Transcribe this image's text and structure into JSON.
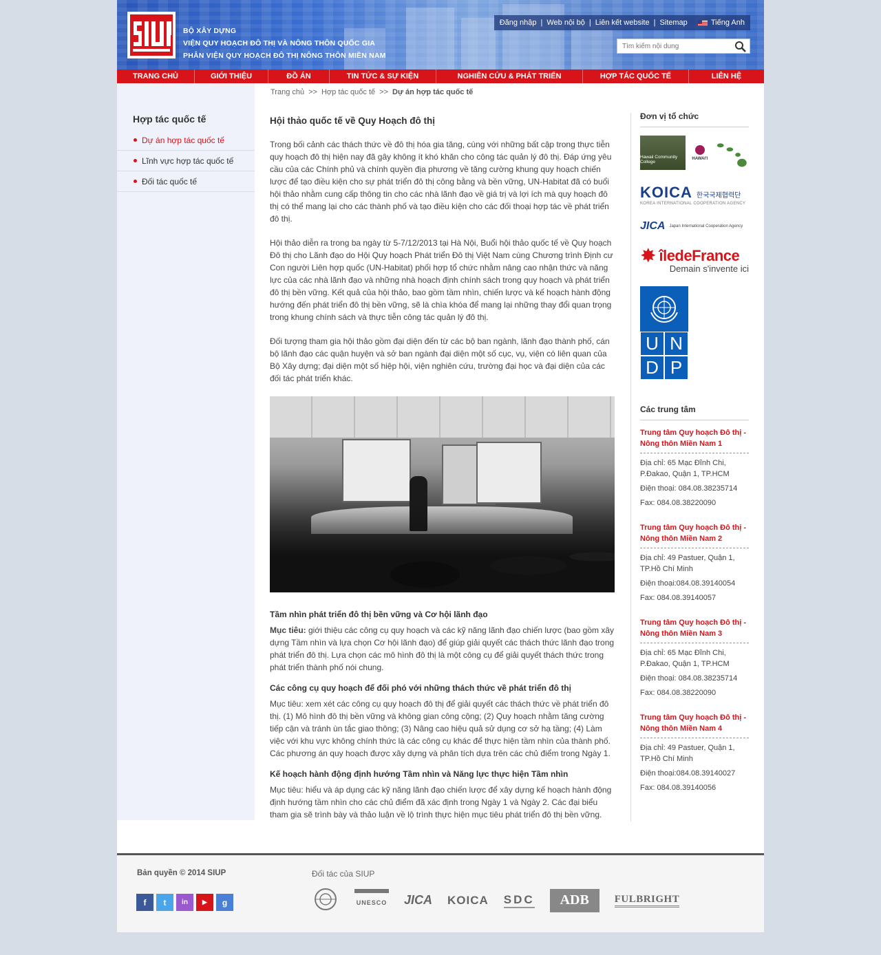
{
  "header": {
    "logo_text": "SIUP",
    "org_lines": [
      "BỘ XÂY DỰNG",
      "VIỆN QUY HOẠCH ĐÔ THỊ VÀ NÔNG THÔN QUỐC GIA",
      "PHÂN VIỆN QUY HOẠCH ĐÔ THỊ NÔNG THÔN MIỀN NAM"
    ],
    "top_links": [
      "Đăng nhập",
      "Web nội bộ",
      "Liên kết website",
      "Sitemap"
    ],
    "language": "Tiếng Anh",
    "search_placeholder": "Tìm kiếm nội dung"
  },
  "nav": [
    "TRANG CHỦ",
    "GIỚI THIỆU",
    "ĐỒ ÁN",
    "TIN TỨC & SỰ KIỆN",
    "NGHIÊN CỨU & PHÁT TRIỂN",
    "HỢP TÁC QUỐC TẾ",
    "LIÊN HỆ"
  ],
  "sidebar": {
    "title": "Hợp tác quốc tế",
    "items": [
      "Dự án hợp tác quốc tế",
      "Lĩnh vực hợp tác quốc tế",
      "Đối tác quốc tế"
    ]
  },
  "breadcrumb": [
    "Trang chủ",
    "Hợp tác quốc tế",
    "Dự án hợp tác quốc tế"
  ],
  "breadcrumb_sep": ">>",
  "article": {
    "title": "Hội thảo quốc tế về Quy Hoạch đô thị",
    "paragraphs": [
      "Trong bối cảnh các thách thức về đô thị hóa gia tăng, cùng với những bất cập trong thực tiễn quy hoạch đô thị hiện nay đã gây không ít khó khăn cho công tác quản lý đô thị. Đáp ứng yêu cầu của các Chính phủ và chính quyền địa phương về tăng cường khung quy hoạch chiến lược để tạo điều kiện cho sự phát triển đô thị công bằng và bền vững, UN-Habitat đã có buổi hội thảo nhằm cung cấp thông tin cho các nhà lãnh đạo về giá trị và lợi ích mà quy hoạch đô thị có thể mang lại cho các thành phố và tạo điều kiện cho các đối thoại hợp tác về phát triển đô thị.",
      "Hội thảo diễn ra trong ba ngày từ 5-7/12/2013 tại Hà Nội, Buổi hội thảo quốc tế về Quy hoạch Đô thị cho Lãnh đạo do Hội Quy hoạch Phát triển Đô thị Việt Nam cùng Chương trình Định cư Con người Liên hợp quốc (UN-Habitat) phối hợp tổ chức nhằm nâng cao nhận thức và năng lực của các nhà lãnh đạo và những nhà hoạch định chính sách trong quy hoạch và phát triển đô thị bền vững. Kết quả của hội thảo, bao gồm tầm nhìn, chiến lược và kế hoạch hành động hướng đến phát triển đô thị bền vững, sẽ là chìa khóa để mang lại những thay đổi quan trọng trong khung chính sách và thực tiễn công tác quản lý đô thị.",
      "Đối tượng tham gia hội thảo gồm đại diện đến từ các bộ ban ngành, lãnh đạo thành phố, cán bộ lãnh đạo các quận huyện và sở ban ngành đại diện một số cục, vụ, viện có liên quan của Bộ Xây dựng; đại diện một số hiệp hội, viện nghiên cứu, trường đại học và đại diện của các đối tác phát triển khác."
    ],
    "sections": [
      {
        "heading": "Tầm nhìn phát triển đô thị bền vững và Cơ hội lãnh đạo",
        "label": "Mục tiêu:",
        "body": " giới thiệu các công cụ quy hoạch và các kỹ năng lãnh đạo chiến lược (bao gồm xây dựng Tầm nhìn và lựa chọn Cơ hội lãnh đạo) để giúp giải quyết các thách thức lãnh đạo trong phát triển đô thị. Lựa chọn các mô hình đô thị là một công cụ để giải quyết thách thức trong phát triển thành phố nói chung."
      },
      {
        "heading": "Các công cụ quy hoạch để đối phó với những thách thức về phát triển đô thị",
        "label": "",
        "body": "Mục tiêu: xem xét các công cụ quy hoạch đô thị để giải quyết các thách thức về phát triển đô thị. (1) Mô hình đô thị bền vững và không gian công cộng; (2) Quy hoạch nhằm tăng cường tiếp cận và tránh ùn tắc giao thông; (3) Nâng cao hiệu quả sử dụng cơ sở hạ tầng; (4) Làm việc với khu vực không chính thức là các công cụ khác để thực hiện tầm nhìn của thành phố. Các phương án quy hoạch được xây dựng và phân tích dựa trên các chủ điểm trong Ngày 1."
      },
      {
        "heading": "Kế hoạch hành động định hướng Tầm nhìn và Năng lực thực hiện Tầm nhìn",
        "label": "",
        "body": "Mục tiêu: hiểu và áp dụng các kỹ năng lãnh đạo chiến lược để xây dựng kế hoạch hành động định hướng tầm nhìn cho các chủ điểm đã xác định trong Ngày 1 và Ngày 2. Các đại biểu tham gia sẽ trình bày và thảo luận về lộ trình thực hiện mục tiêu phát triển đô thị bền vững."
      }
    ]
  },
  "right": {
    "org_title": "Đơn vị tổ chức",
    "org_logos": {
      "hawaii": "Hawaii Community College",
      "hawaii_short": "HAWAI'I",
      "koica": "KOICA",
      "koica_korean": "한국국제협력단",
      "koica_full": "KOREA INTERNATIONAL COOPERATION AGENCY",
      "jica": "JICA",
      "jica_full": "Japan International Cooperation Agency",
      "idf": "îledeFrance",
      "idf_tag": "Demain s'invente ici",
      "undp_letters": [
        "U",
        "N",
        "D",
        "P"
      ]
    },
    "centers_title": "Các trung tâm",
    "centers": [
      {
        "title": "Trung tâm Quy hoạch Đô thị - Nông thôn Miền Nam 1",
        "address": "Địa chỉ: 65 Mạc Đĩnh Chi, P.Đakao, Quận 1, TP.HCM",
        "phone": "Điện thoại: 084.08.38235714",
        "fax": "Fax: 084.08.38220090"
      },
      {
        "title": "Trung tâm Quy hoạch Đô thị - Nông thôn Miền Nam 2",
        "address": "Địa chỉ: 49 Pastuer, Quận 1, TP.Hồ Chí Minh",
        "phone": "Điện thoại:084.08.39140054",
        "fax": "Fax: 084.08.39140057"
      },
      {
        "title": "Trung tâm Quy hoạch Đô thị - Nông thôn Miền Nam 3",
        "address": "Địa chỉ: 65 Mạc Đĩnh Chi, P.Đakao, Quận 1, TP.HCM",
        "phone": "Điện thoại: 084.08.38235714",
        "fax": "Fax: 084.08.38220090"
      },
      {
        "title": "Trung tâm Quy hoạch Đô thị - Nông thôn Miền Nam 4",
        "address": "Địa chỉ: 49 Pastuer, Quận 1, TP.Hồ Chí Minh",
        "phone": "Điện thoại:084.08.39140027",
        "fax": "Fax: 084.08.39140056"
      }
    ]
  },
  "footer": {
    "copyright": "Bản quyền © 2014 SIUP",
    "partners_title": "Đối tác của SIUP",
    "social": [
      {
        "name": "facebook",
        "glyph": "f",
        "color": "#3b5998"
      },
      {
        "name": "twitter",
        "glyph": "t",
        "color": "#4aa6e8"
      },
      {
        "name": "linkedin",
        "glyph": "in",
        "color": "#9b59d0"
      },
      {
        "name": "youtube",
        "glyph": "▶",
        "color": "#d7141a"
      },
      {
        "name": "google",
        "glyph": "g",
        "color": "#4a7fd6"
      }
    ],
    "partners": [
      "UN",
      "UNESCO",
      "JICA",
      "KOICA",
      "SDC",
      "ADB",
      "FULBRIGHT"
    ]
  }
}
